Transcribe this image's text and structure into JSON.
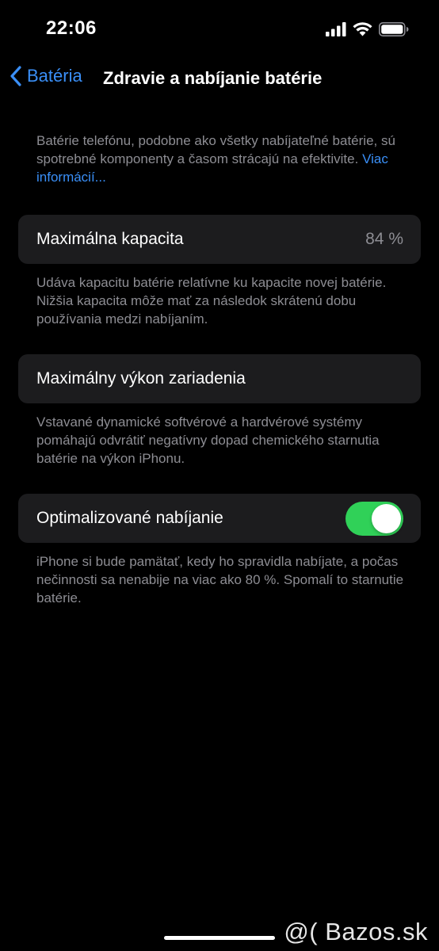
{
  "status_bar": {
    "time": "22:06",
    "icons": [
      "cellular-signal-icon",
      "wifi-icon",
      "battery-icon"
    ]
  },
  "nav": {
    "back_label": "Batéria",
    "title": "Zdravie a nabíjanie batérie"
  },
  "intro": {
    "text": "Batérie telefónu, podobne ako všetky nabíjateľné batérie, sú spotrebné komponenty a časom strácajú na efektivite.",
    "link": "Viac informácií..."
  },
  "max_capacity": {
    "label": "Maximálna kapacita",
    "value": "84 %",
    "description": "Udáva kapacitu batérie relatívne ku kapacite novej batérie. Nižšia kapacita môže mať za následok skrátenú dobu používania medzi nabíjaním."
  },
  "peak_performance": {
    "label": "Maximálny výkon zariadenia",
    "description": "Vstavané dynamické softvérové a hardvérové systémy pomáhajú odvrátiť negatívny dopad chemického starnutia batérie na výkon iPhonu."
  },
  "optimized_charging": {
    "label": "Optimalizované nabíjanie",
    "enabled": true,
    "description": "iPhone si bude pamätať, kedy ho spravidla nabíjate, a počas nečinnosti sa nenabije na viac ako 80 %. Spomalí to starnutie batérie."
  },
  "watermark": "@( Bazos.sk",
  "colors": {
    "background": "#000000",
    "card": "#1c1c1e",
    "accent_blue": "#3a8ff7",
    "toggle_on": "#30d158",
    "secondary_text": "#8d8d93"
  }
}
